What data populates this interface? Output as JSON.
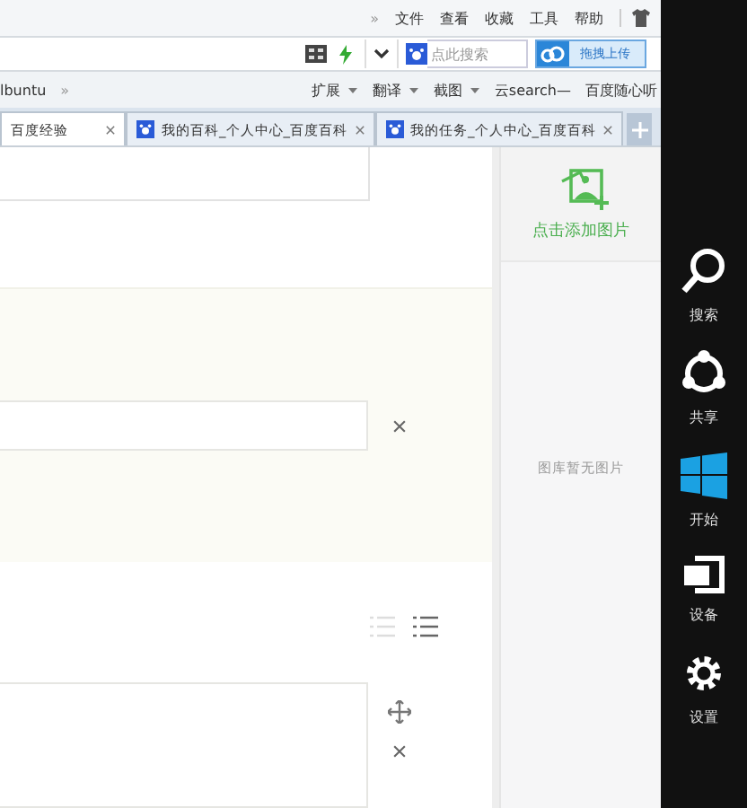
{
  "menu_bar": {
    "overflow": "»",
    "items": [
      "文件",
      "查看",
      "收藏",
      "工具",
      "帮助"
    ]
  },
  "address_bar": {
    "search": {
      "placeholder": "点此搜索"
    },
    "upload_button": "拖拽上传"
  },
  "bookmarks_bar": {
    "items": [
      {
        "label": "lbuntu",
        "kind": "link"
      },
      {
        "label": "»",
        "kind": "overflow"
      },
      {
        "label": "扩展",
        "kind": "menu"
      },
      {
        "label": "翻译",
        "kind": "menu"
      },
      {
        "label": "截图",
        "kind": "menu"
      },
      {
        "label": "云search—",
        "kind": "link"
      },
      {
        "label": "百度随心听",
        "kind": "link"
      }
    ]
  },
  "tabs": [
    {
      "label": "百度经验",
      "selected": true
    },
    {
      "label": "我的百科_个人中心_百度百科",
      "selected": false
    },
    {
      "label": "我的任务_个人中心_百度百科",
      "selected": false
    }
  ],
  "image_panel": {
    "add_label": "点击添加图片",
    "empty_label": "图库暂无图片"
  },
  "charms": [
    {
      "label": "搜索",
      "kind": "search"
    },
    {
      "label": "共享",
      "kind": "share"
    },
    {
      "label": "开始",
      "kind": "start"
    },
    {
      "label": "设备",
      "kind": "devices"
    },
    {
      "label": "设置",
      "kind": "settings"
    }
  ]
}
